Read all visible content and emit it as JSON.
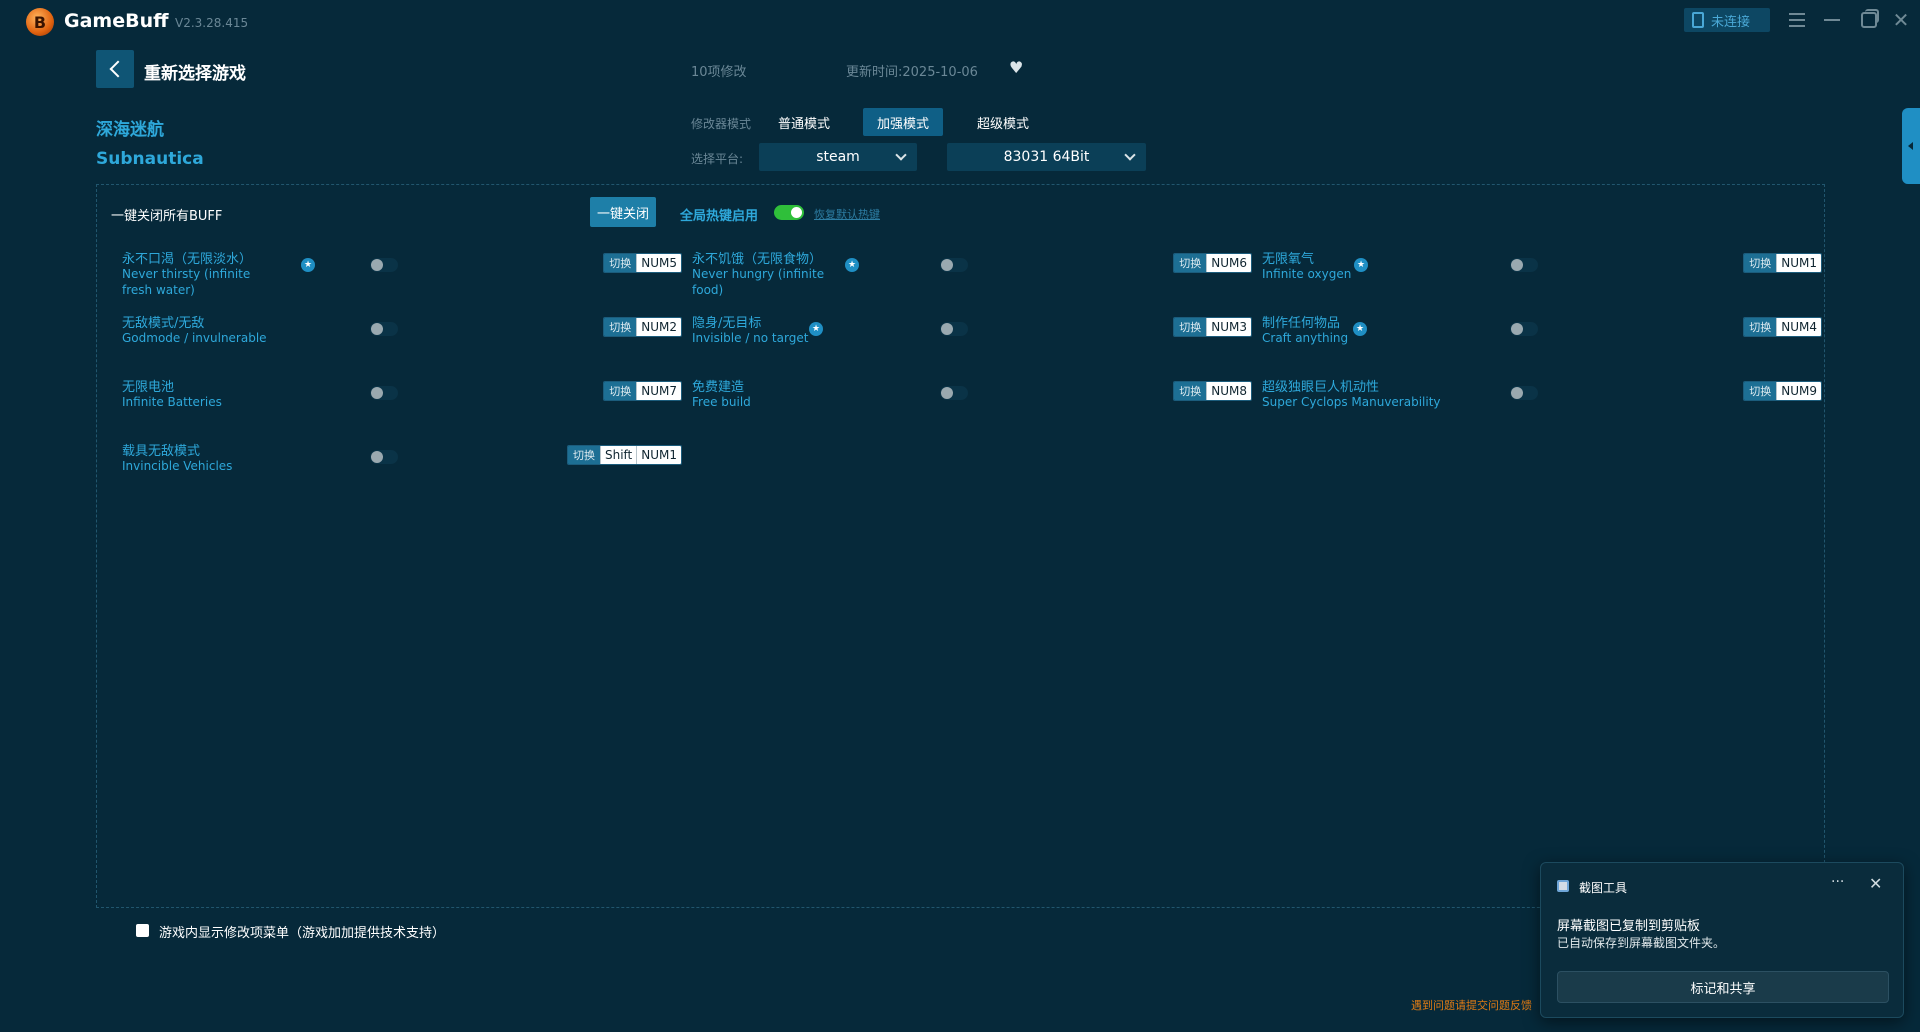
{
  "app": {
    "name": "GameBuff",
    "version": "V2.3.28.415",
    "connection_label": "未连接"
  },
  "header": {
    "back_label": "重新选择游戏",
    "mod_count": "10项修改",
    "update_time": "更新时间:2025-10-06"
  },
  "game": {
    "name_cn": "深海迷航",
    "name_en": "Subnautica"
  },
  "modes": {
    "label": "修改器模式",
    "items": [
      "普通模式",
      "加强模式",
      "超级模式"
    ],
    "active": "加强模式"
  },
  "platform": {
    "label": "选择平台:",
    "selected": "steam",
    "version": "83031 64Bit"
  },
  "panel": {
    "close_all_label": "一键关闭所有BUFF",
    "close_all_button": "一键关闭",
    "hotkey_label": "全局热键启用",
    "hotkey_enabled": true,
    "restore_link": "恢复默认热键"
  },
  "switch_label": "切换",
  "cheats": [
    {
      "cn": "永不口渴（无限淡水）",
      "en": "Never thirsty (infinite fresh water)",
      "starred": true,
      "enabled": false,
      "keys": [
        "NUM5"
      ]
    },
    {
      "cn": "永不饥饿（无限食物）",
      "en": "Never hungry (infinite food)",
      "starred": true,
      "enabled": false,
      "keys": [
        "NUM6"
      ]
    },
    {
      "cn": "无限氧气",
      "en": "Infinite oxygen",
      "starred": true,
      "enabled": false,
      "keys": [
        "NUM1"
      ]
    },
    {
      "cn": "无敌模式/无敌",
      "en": "Godmode / invulnerable",
      "starred": false,
      "enabled": false,
      "keys": [
        "NUM2"
      ]
    },
    {
      "cn": "隐身/无目标",
      "en": "Invisible / no target",
      "starred": true,
      "enabled": false,
      "keys": [
        "NUM3"
      ]
    },
    {
      "cn": "制作任何物品",
      "en": "Craft anything",
      "starred": true,
      "enabled": false,
      "keys": [
        "NUM4"
      ]
    },
    {
      "cn": "无限电池",
      "en": "Infinite Batteries",
      "starred": false,
      "enabled": false,
      "keys": [
        "NUM7"
      ]
    },
    {
      "cn": "免费建造",
      "en": "Free build",
      "starred": false,
      "enabled": false,
      "keys": [
        "NUM8"
      ]
    },
    {
      "cn": "超级独眼巨人机动性",
      "en": "Super Cyclops Manuverability",
      "starred": false,
      "enabled": false,
      "keys": [
        "NUM9"
      ]
    },
    {
      "cn": "载具无敌模式",
      "en": "Invincible Vehicles",
      "starred": false,
      "enabled": false,
      "keys": [
        "Shift",
        "NUM1"
      ]
    }
  ],
  "footer": {
    "ingame_menu_label": "游戏内显示修改项菜单（游戏加加提供技术支持）",
    "feedback": "遇到问题请提交问题反馈"
  },
  "toast": {
    "app": "截图工具",
    "title": "屏幕截图已复制到剪贴板",
    "body": "已自动保存到屏幕截图文件夹。",
    "button": "标记和共享",
    "more": "···"
  },
  "icons": {
    "back": "chevron-left-icon",
    "heart": "heart-icon",
    "star": "star-icon",
    "close": "close-icon"
  },
  "colors": {
    "background": "#06293a",
    "accent": "#2ea8da",
    "toggle_on": "#2fbf3a",
    "warning": "#e07b14"
  }
}
